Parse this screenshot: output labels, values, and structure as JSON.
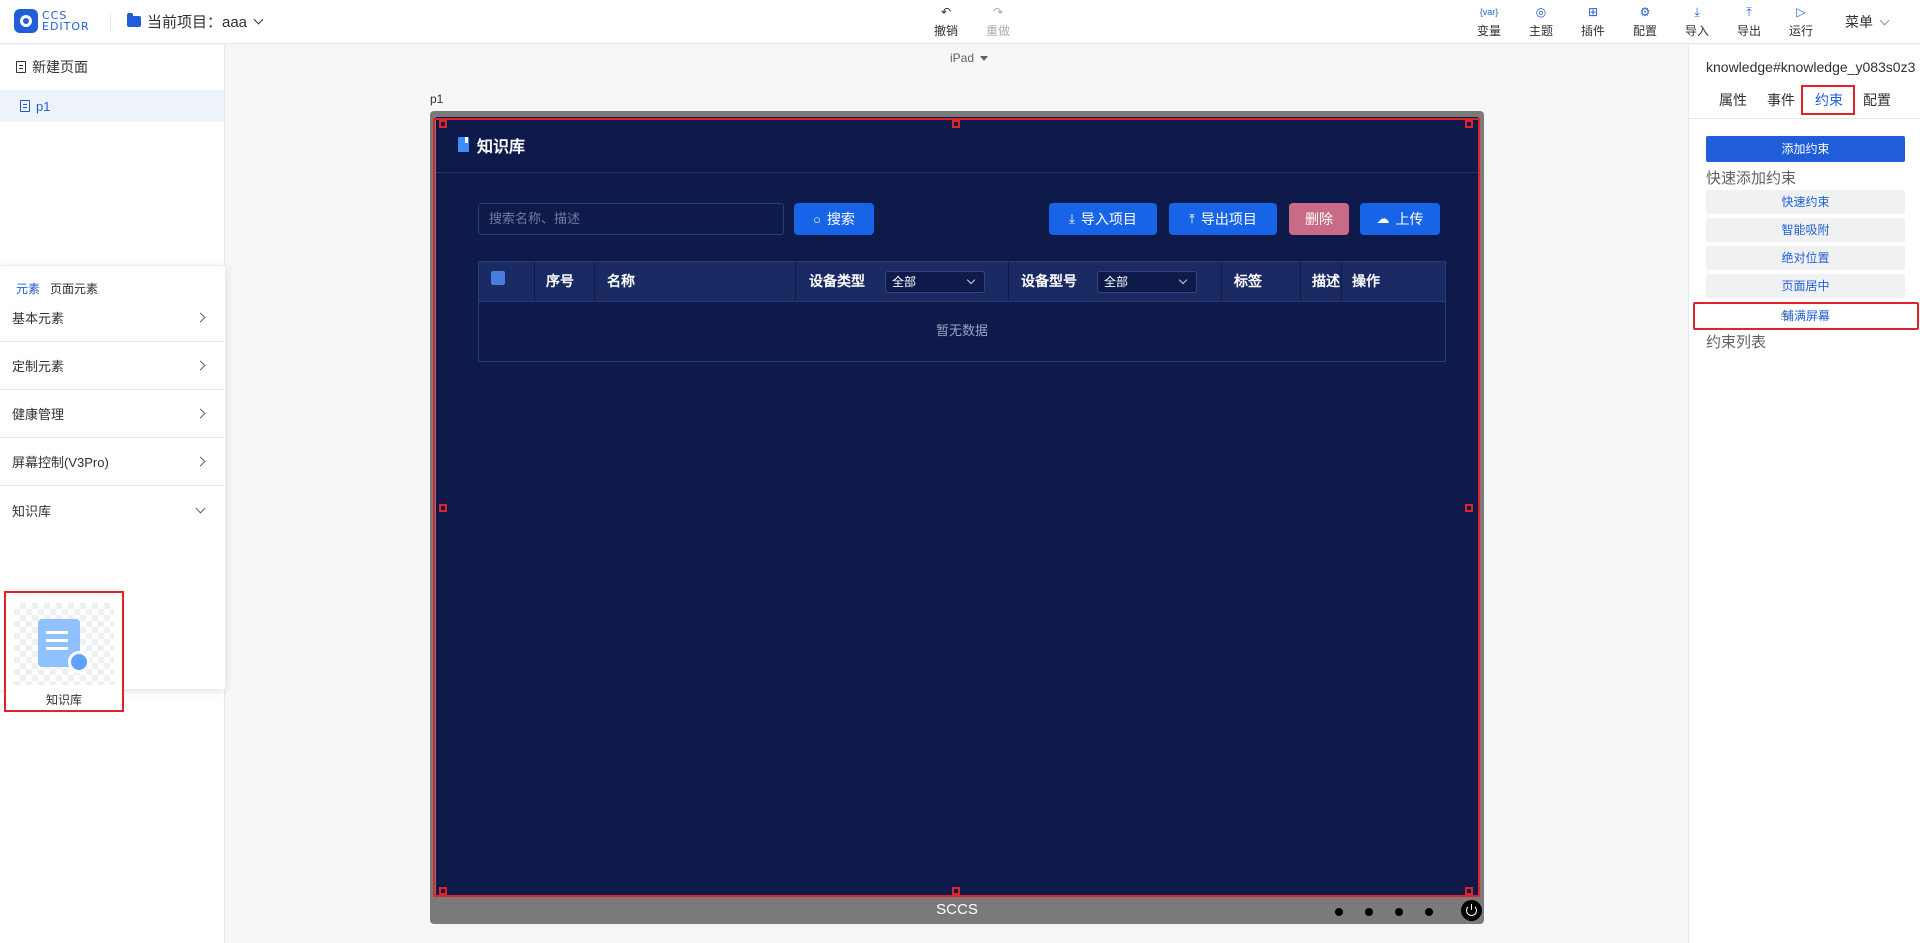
{
  "topbar": {
    "logo_text_1": "CCS",
    "logo_text_2": "EDITOR",
    "project_label": "当前项目：aaa",
    "undo_label": "撤销",
    "redo_label": "重做",
    "tools": [
      {
        "label": "变量",
        "icon": "{var}"
      },
      {
        "label": "主题",
        "icon": "◎"
      },
      {
        "label": "插件",
        "icon": "⊞"
      },
      {
        "label": "配置",
        "icon": "⚙"
      },
      {
        "label": "导入",
        "icon": "⤓"
      },
      {
        "label": "导出",
        "icon": "⤒"
      },
      {
        "label": "运行",
        "icon": "▷"
      }
    ],
    "menu_label": "菜单"
  },
  "left_panel": {
    "new_page_label": "新建页面",
    "pages": [
      {
        "label": "p1"
      }
    ],
    "element_tabs": [
      "元素",
      "页面元素"
    ],
    "categories": [
      {
        "label": "基本元素"
      },
      {
        "label": "定制元素"
      },
      {
        "label": "健康管理"
      },
      {
        "label": "屏幕控制(V3Pro)"
      },
      {
        "label": "知识库"
      }
    ],
    "component_card_label": "知识库"
  },
  "canvas": {
    "device_select": "iPad",
    "page_label": "p1",
    "device_name": "SCCS",
    "widget": {
      "title": "知识库",
      "search_placeholder": "搜索名称、描述",
      "search_button": "搜索",
      "import_button": "导入项目",
      "export_button": "导出项目",
      "delete_button": "删除",
      "upload_button": "上传",
      "columns": {
        "index": "序号",
        "name": "名称",
        "device_type": "设备类型",
        "device_type_filter": "全部",
        "device_model": "设备型号",
        "device_model_filter": "全部",
        "tag": "标签",
        "desc": "描述",
        "action": "操作"
      },
      "empty_text": "暂无数据"
    }
  },
  "right_panel": {
    "component_id": "knowledge#knowledge_y083s0z3",
    "tabs": [
      "属性",
      "事件",
      "约束",
      "配置"
    ],
    "active_tab": "约束",
    "add_constraint": "添加约束",
    "quick_add_title": "快速添加约束",
    "quick_buttons": [
      "快速约束",
      "智能吸附",
      "绝对位置",
      "页面居中",
      "铺满屏幕"
    ],
    "constraint_list_title": "约束列表"
  },
  "colors": {
    "primary": "#1f5ed8",
    "highlight": "#e0232b",
    "screen_bg": "#0e1b4a",
    "delete_btn": "#c96a86"
  }
}
